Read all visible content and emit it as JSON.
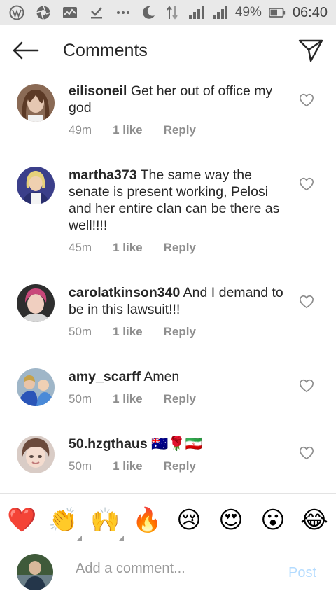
{
  "status_bar": {
    "battery": "49%",
    "time": "06:40",
    "icons": [
      "wordpress-icon",
      "aperture-icon",
      "activity-icon",
      "download-check-icon",
      "more-dots-icon",
      "moon-icon",
      "data-arrows-icon",
      "signal-h-icon",
      "signal-icon",
      "battery-icon"
    ]
  },
  "header": {
    "title": "Comments"
  },
  "comments": [
    {
      "user": "eilisoneil",
      "text": "Get her out of office my god",
      "time": "49m",
      "likes": "1 like",
      "reply": "Reply"
    },
    {
      "user": "martha373",
      "text": "The same way the senate is present working, Pelosi and her entire clan can be there as well!!!!",
      "time": "45m",
      "likes": "1 like",
      "reply": "Reply"
    },
    {
      "user": "carolatkinson340",
      "text": "And I demand to be in this lawsuit!!!",
      "time": "50m",
      "likes": "1 like",
      "reply": "Reply"
    },
    {
      "user": "amy_scarff",
      "text": "Amen",
      "time": "50m",
      "likes": "1 like",
      "reply": "Reply"
    },
    {
      "user": "50.hzgthaus",
      "text": "🇦🇺🌹🇮🇷",
      "time": "50m",
      "likes": "1 like",
      "reply": "Reply"
    }
  ],
  "emojis": [
    "❤️",
    "👏",
    "🙌",
    "🔥",
    "😢",
    "😍",
    "😮",
    "😂"
  ],
  "compose": {
    "placeholder": "Add a comment...",
    "post_label": "Post"
  },
  "colors": {
    "post_disabled": "#b3dbff",
    "meta_gray": "#8e8e8e",
    "text": "#262626"
  }
}
